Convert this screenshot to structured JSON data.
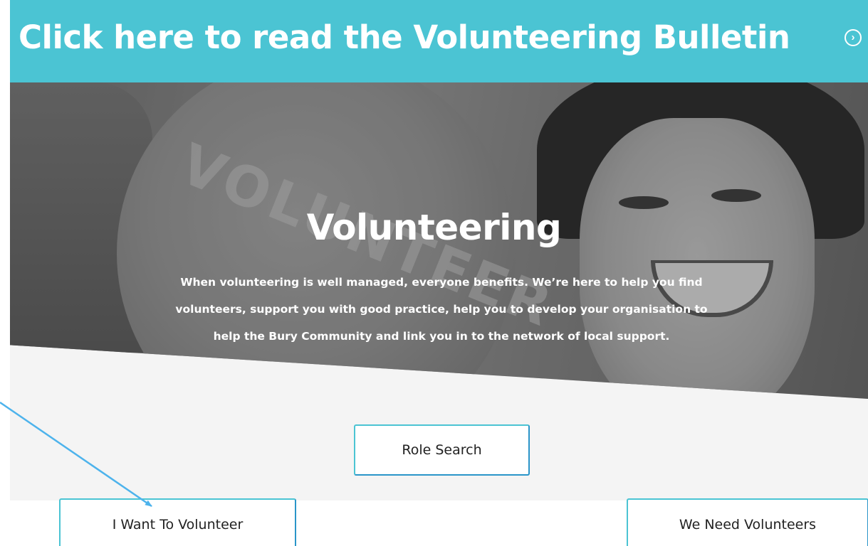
{
  "banner": {
    "text": "Click here to read the Volunteering Bulletin",
    "icon": "chevron-right-circle-icon",
    "background_color": "#4bc4d3"
  },
  "hero": {
    "image_text": "VOLUNTEER",
    "title": "Volunteering",
    "description": "When volunteering is well managed, everyone benefits. We’re here to help you find volunteers, support you with good practice, help you to develop your organisation to help the Bury Community and link you in to the network of local support."
  },
  "buttons": {
    "role_search": "Role Search",
    "i_want_to_volunteer": "I Want To Volunteer",
    "we_need_volunteers": "We Need Volunteers"
  },
  "annotation": {
    "arrow_color": "#4db3ec"
  }
}
